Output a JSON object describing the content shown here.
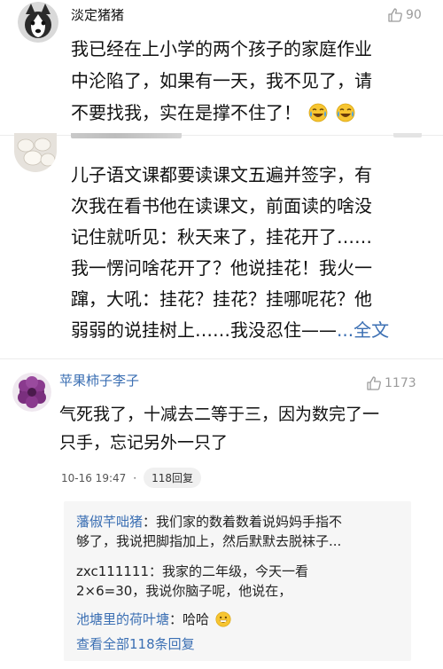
{
  "comment1": {
    "username": "淡定猪猪",
    "likes": "90",
    "lines": [
      "我已经在上小学的两个孩子的家庭作业",
      "中沦陷了，如果有一天，我不见了，请",
      "不要找我，实在是撑不住了！"
    ],
    "emoji": "crying-laughing-emoji"
  },
  "comment2": {
    "lines": [
      "儿子语文课都要读课文五遍并签字，有",
      "次我在看书他在读课文，前面读的啥没",
      "记住就听见：秋天来了，挂花开了……",
      "我一愣问啥花开了？他说挂花！我火一",
      "蹿，大吼：挂花？挂花？挂哪呢花？他",
      "弱弱的说挂树上……我没忍住——"
    ],
    "more": "...全文"
  },
  "comment3": {
    "username": "苹果柿子李子",
    "username_color": "#3b6fb3",
    "likes": "1173",
    "lines": [
      "气死我了，十减去二等于三，因为数完了一",
      "只手，忘记另外一只了"
    ],
    "timestamp": "10-16 19:47",
    "dot": "·",
    "reply_count": "118回复",
    "replies": [
      {
        "name": "藩俶芊咄猪",
        "text_lines": [
          "：我们家的数着数着说妈妈手指不",
          "够了，我说把脚指加上，然后默默去脱袜子..."
        ]
      },
      {
        "name": "zxc111111",
        "text_lines": [
          "：我家的二年级，今天一看",
          "2×6=30，我说你脑子呢，他说在，"
        ]
      },
      {
        "name": "池塘里的荷叶塘",
        "text_lines": [
          "：哈哈"
        ],
        "emoji": "grinning-emoji"
      }
    ],
    "view_all": "查看全部118条回复"
  }
}
